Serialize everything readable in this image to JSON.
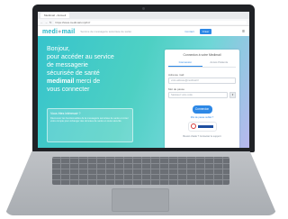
{
  "browser": {
    "tab_title": "Medimail - Accueil",
    "url": "https://www.medimail.mipih.fr"
  },
  "site": {
    "logo_main": "medi",
    "logo_accent": "mail",
    "tagline": "Service de messagerie sécurisée de santé",
    "header_link": "Contact",
    "header_button": "Créer",
    "menu_glyph": "≡"
  },
  "hero": {
    "line1": "Bonjour,",
    "line2": "pour accéder au service",
    "line3": "de messagerie",
    "line4": "sécurisée de santé",
    "brand": "medimail",
    "line5_suffix": "merci de",
    "line6": "vous connecter"
  },
  "info_box": {
    "title": "Vous êtes intéressé ?",
    "body": "Découvrez les fonctionnalités de la messagerie sécurisée de santé et créez votre compte pour échanger des données de santé en toute sécurité."
  },
  "login_card": {
    "title": "Connexion à votre Medimail",
    "tabs": [
      "Connexion",
      "Accès Patients"
    ],
    "active_tab": 0,
    "email_label": "Adresse mail",
    "email_placeholder": "votre.adresse@medimail.fr",
    "auth_label": "Mot de passe",
    "auth_placeholder": "Saisissez votre code",
    "connect_label": "Connexion",
    "forgot_label": "Mot de passe oublié ?",
    "footer": "Besoin d'aide ? Contactez le support"
  },
  "colors": {
    "brand": "#27b7c9",
    "accent": "#2d88e6"
  }
}
